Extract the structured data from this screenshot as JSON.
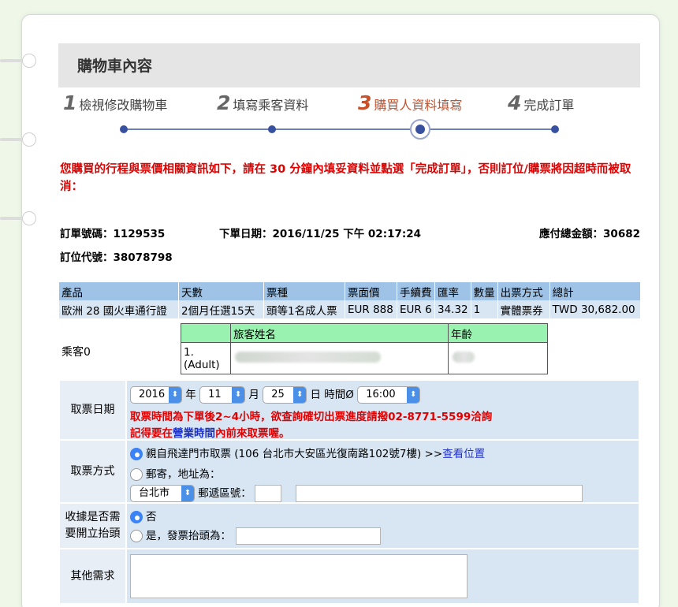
{
  "header": {
    "title": "購物車內容"
  },
  "steps": [
    {
      "num": "1",
      "label": "檢視修改購物車"
    },
    {
      "num": "2",
      "label": "填寫乘客資料"
    },
    {
      "num": "3",
      "label": "購買人資料填寫"
    },
    {
      "num": "4",
      "label": "完成訂單"
    }
  ],
  "warning": "您購買的行程與票價相關資訊如下，請在 30 分鐘內填妥資料並點選「完成訂單」，否則訂位/購票將因超時而被取消：",
  "order": {
    "order_no": "訂單號碼：1129535",
    "order_date": "下單日期：2016/11/25 下午 02:17:24",
    "total": "應付總金額：30682",
    "booking_code": "訂位代號：38078798"
  },
  "table": {
    "headers": [
      "產品",
      "天數",
      "票種",
      "票面價",
      "手續費",
      "匯率",
      "數量",
      "出票方式",
      "總計"
    ],
    "row": [
      "歐洲 28 國火車通行證",
      "2個月任選15天",
      "頭等1名成人票",
      "EUR 888",
      "EUR 6",
      "34.32",
      "1",
      "實體票券",
      "TWD 30,682.00"
    ]
  },
  "passenger": {
    "label": "乘客0",
    "col_name": "旅客姓名",
    "col_age": "年齡",
    "index": "1.",
    "type": "(Adult)"
  },
  "pickup_date": {
    "label": "取票日期",
    "year": "2016",
    "year_unit": "年",
    "month": "11",
    "month_unit": "月",
    "day": "25",
    "day_unit": "日",
    "time_label": "時間Ø",
    "time": "16:00",
    "note1": "取票時間為下單後2~4小時，欲查詢確切出票進度請撥02-8771-5599洽詢",
    "note2a": "記得要在",
    "note2b": "營業時間",
    "note2c": "內前來取票喔。"
  },
  "pickup_method": {
    "label": "取票方式",
    "option1": "親自飛達門市取票 (106 台北市大安區光復南路102號7樓) >>",
    "option1_link": "查看位置",
    "option2": "郵寄，地址為：",
    "city": "台北市",
    "zip_label": "郵遞區號："
  },
  "receipt": {
    "label1": "收據是否需",
    "label2": "要開立抬頭",
    "no": "否",
    "yes": "是，發票抬頭為："
  },
  "other": {
    "label": "其他需求"
  },
  "colors": {
    "accent": "#3850a0",
    "warn": "#e00000",
    "active_step": "#c8502a",
    "table_head": "#9fc3e6",
    "form_bg": "#d8e5f3"
  }
}
